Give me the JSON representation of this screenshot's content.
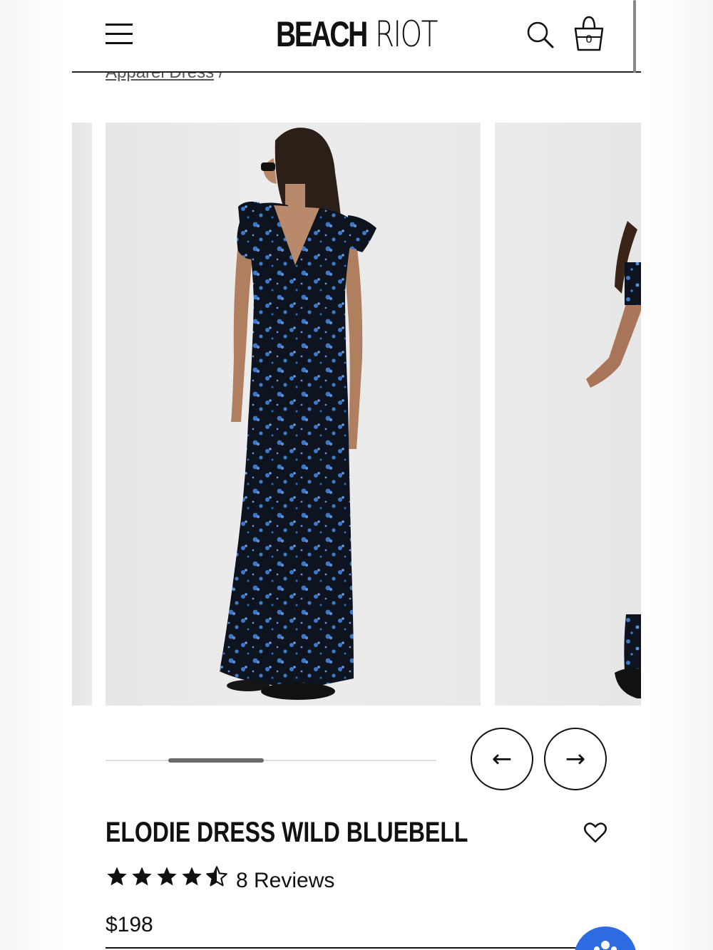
{
  "header": {
    "menu_icon": "hamburger-menu-icon",
    "logo_bold": "BEACH",
    "logo_thin": "RIOT",
    "search_icon": "search-icon",
    "bag_icon": "shopping-bag-icon",
    "bag_count": "0"
  },
  "breadcrumb": {
    "link": "Apparel Dress",
    "separator": "/"
  },
  "gallery": {
    "prev_icon": "arrow-left-icon",
    "next_icon": "arrow-right-icon",
    "prev_arrow": "←",
    "next_arrow": "→",
    "progress": 0.29
  },
  "product": {
    "title": "ELODIE DRESS WILD BLUEBELL",
    "rating": 4.5,
    "reviews": "8 Reviews",
    "price": "$198",
    "wishlist_icon": "heart-icon"
  },
  "colors": {
    "accent": "#2d6be3",
    "dress": "#0d1420",
    "flower": "#3d78c9"
  }
}
